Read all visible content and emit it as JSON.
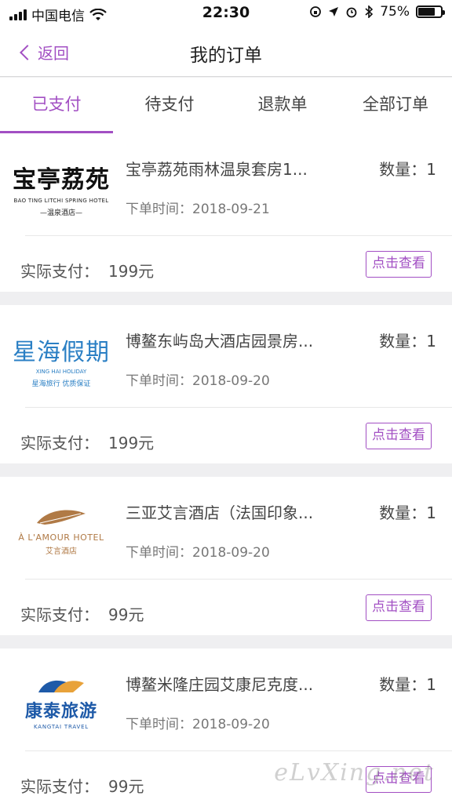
{
  "status_bar": {
    "carrier": "中国电信",
    "time": "22:30",
    "battery": "75%",
    "battery_level": 0.75
  },
  "nav": {
    "back_label": "返回",
    "title": "我的订单"
  },
  "tabs": [
    {
      "label": "已支付",
      "active": true
    },
    {
      "label": "待支付",
      "active": false
    },
    {
      "label": "退款单",
      "active": false
    },
    {
      "label": "全部订单",
      "active": false
    }
  ],
  "orders": [
    {
      "logo": {
        "title": "宝亭荔苑",
        "sub": "BAO TING LITCHI SPRING HOTEL",
        "sub2": "—温泉酒店—"
      },
      "name": "宝亭荔苑雨林温泉套房1...",
      "qty_label": "数量：1",
      "time_label": "下单时间：",
      "time": "2018-09-21",
      "paid_label": "实际支付：",
      "paid": "199元",
      "button": "点击查看"
    },
    {
      "logo": {
        "title": "星海假期",
        "sub": "XING HAI HOLIDAY",
        "sub2": "星海旅行 优质保证"
      },
      "name": "博鳌东屿岛大酒店园景房...",
      "qty_label": "数量：1",
      "time_label": "下单时间：",
      "time": "2018-09-20",
      "paid_label": "实际支付：",
      "paid": "199元",
      "button": "点击查看"
    },
    {
      "logo": {
        "title": "À L'AMOUR HOTEL",
        "sub": "艾言酒店"
      },
      "name": "三亚艾言酒店（法国印象...",
      "qty_label": "数量：1",
      "time_label": "下单时间：",
      "time": "2018-09-20",
      "paid_label": "实际支付：",
      "paid": "99元",
      "button": "点击查看"
    },
    {
      "logo": {
        "title": "康泰旅游",
        "sub": "KANGTAI TRAVEL"
      },
      "name": "博鳌米隆庄园艾康尼克度...",
      "qty_label": "数量：1",
      "time_label": "下单时间：",
      "time": "2018-09-20",
      "paid_label": "实际支付：",
      "paid": "99元",
      "button": "点击查看"
    }
  ],
  "watermark": "eLvXing.net",
  "colors": {
    "accent": "#a24fc3",
    "background": "#efeff1"
  }
}
